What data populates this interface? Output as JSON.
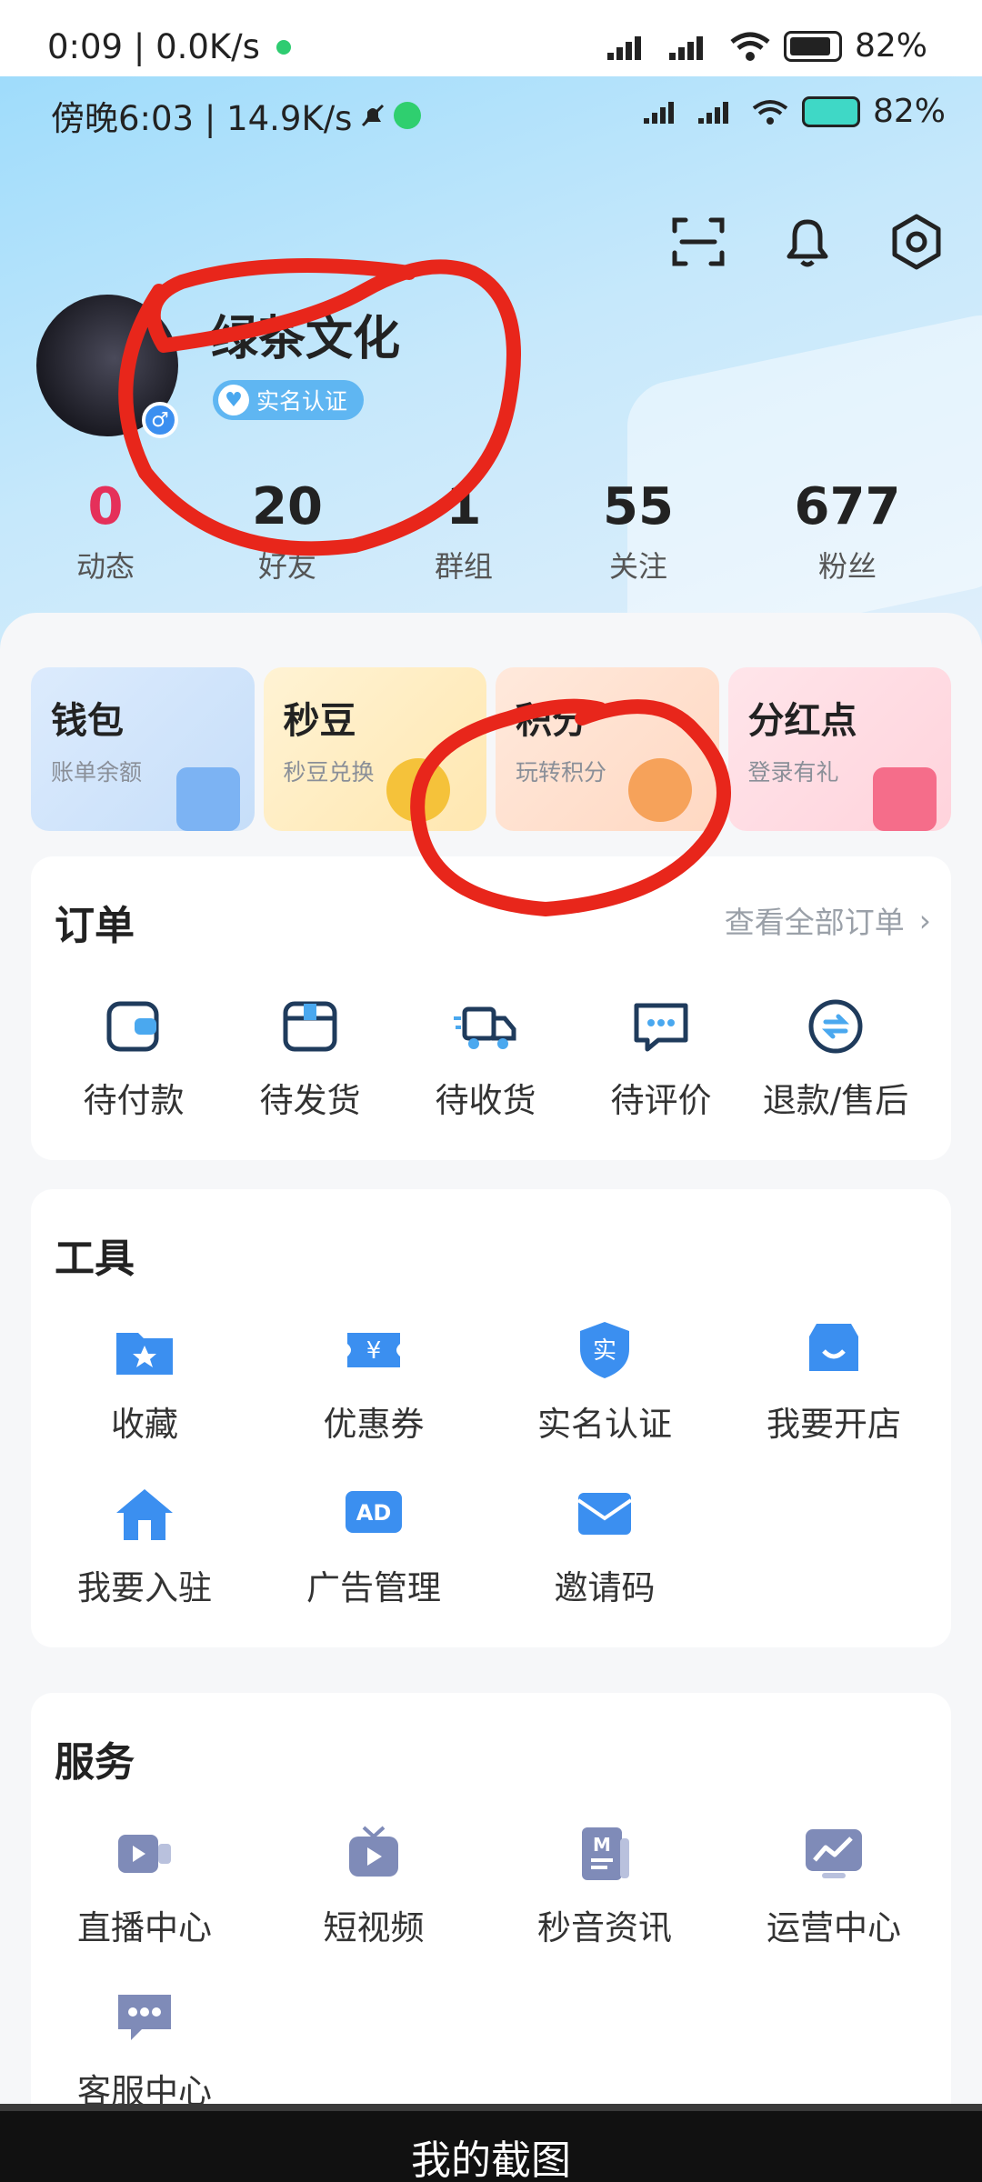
{
  "outer_status": {
    "time_speed": "0:09 | 0.0K/s",
    "battery": "82%"
  },
  "inner_status": {
    "time_speed": "傍晚6:03 | 14.9K/s",
    "battery": "82%"
  },
  "profile": {
    "username": "绿茶文化",
    "verify_label": "实名认证",
    "stats": [
      {
        "value": "0",
        "label": "动态"
      },
      {
        "value": "20",
        "label": "好友"
      },
      {
        "value": "1",
        "label": "群组"
      },
      {
        "value": "55",
        "label": "关注"
      },
      {
        "value": "677",
        "label": "粉丝"
      }
    ]
  },
  "features": [
    {
      "title": "钱包",
      "subtitle": "账单余额"
    },
    {
      "title": "秒豆",
      "subtitle": "秒豆兑换"
    },
    {
      "title": "积分",
      "subtitle": "玩转积分"
    },
    {
      "title": "分红点",
      "subtitle": "登录有礼"
    }
  ],
  "orders": {
    "title": "订单",
    "link": "查看全部订单",
    "items": [
      {
        "label": "待付款",
        "icon": "wallet-icon"
      },
      {
        "label": "待发货",
        "icon": "package-icon"
      },
      {
        "label": "待收货",
        "icon": "truck-icon"
      },
      {
        "label": "待评价",
        "icon": "comment-icon"
      },
      {
        "label": "退款/售后",
        "icon": "refund-icon"
      }
    ]
  },
  "tools": {
    "title": "工具",
    "items": [
      {
        "label": "收藏",
        "icon": "favorite-folder-icon"
      },
      {
        "label": "优惠券",
        "icon": "coupon-icon"
      },
      {
        "label": "实名认证",
        "icon": "verify-shield-icon"
      },
      {
        "label": "我要开店",
        "icon": "shop-icon"
      },
      {
        "label": "我要入驻",
        "icon": "house-icon"
      },
      {
        "label": "广告管理",
        "icon": "ad-icon"
      },
      {
        "label": "邀请码",
        "icon": "invite-mail-icon"
      }
    ]
  },
  "services": {
    "title": "服务",
    "items": [
      {
        "label": "直播中心",
        "icon": "live-camera-icon"
      },
      {
        "label": "短视频",
        "icon": "short-video-icon"
      },
      {
        "label": "秒音资讯",
        "icon": "news-doc-icon"
      },
      {
        "label": "运营中心",
        "icon": "analytics-icon"
      },
      {
        "label": "客服中心",
        "icon": "customer-service-icon"
      }
    ]
  },
  "caption": "我的截图",
  "colors": {
    "accent_blue": "#3b8ff0",
    "red_count": "#e5305a",
    "annotation_red": "#e8261b"
  }
}
